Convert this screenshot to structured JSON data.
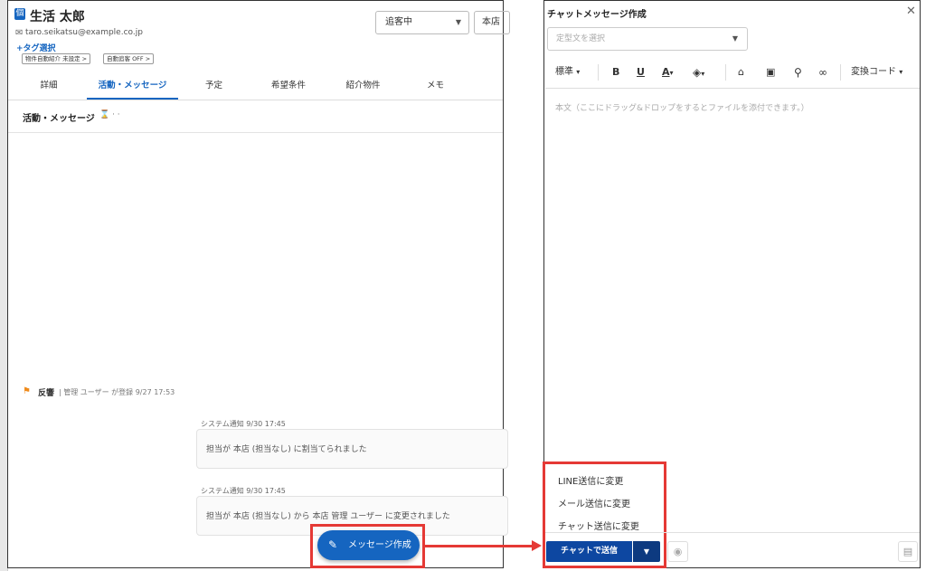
{
  "customer": {
    "name": "生活 太郎",
    "email": "taro.seikatsu@example.co.jp",
    "tag_add_label": "+タグ選択",
    "chips": [
      "物件自動紹介 未設定 >",
      "自動追客 OFF >"
    ],
    "status_value": "追客中",
    "store_value": "本店"
  },
  "tabs": [
    "詳細",
    "活動・メッセージ",
    "予定",
    "希望条件",
    "紹介物件",
    "メモ"
  ],
  "active_tab": "活動・メッセージ",
  "activity": {
    "section_title": "活動・メッセージ",
    "event_label": "反響",
    "event_detail": "| 管理 ユーザー が登録 9/27 17:53",
    "notices": [
      {
        "time": "システム通知 9/30 17:45",
        "text": "担当が 本店 (担当なし) に割当てられました"
      },
      {
        "time": "システム通知 9/30 17:45",
        "text": "担当が 本店 (担当なし) から 本店 管理 ユーザー に変更されました"
      }
    ],
    "compose_button": "メッセージ作成"
  },
  "dialog": {
    "title": "チャットメッセージ作成",
    "template_placeholder": "定型文を選択",
    "toolbar": {
      "style": "標準",
      "bold": "B",
      "underline": "U",
      "font_color": "A",
      "convert_code": "変換コード"
    },
    "body_placeholder": "本文（ここにドラッグ&ドロップをするとファイルを添付できます。）",
    "send_menu": [
      "LINE送信に変更",
      "メール送信に変更",
      "チャット送信に変更"
    ],
    "send_button": "チャットで送信"
  },
  "colors": {
    "accent": "#1565c0",
    "send": "#0d47a1",
    "highlight": "#e53935",
    "flag": "#ef8a1b"
  }
}
